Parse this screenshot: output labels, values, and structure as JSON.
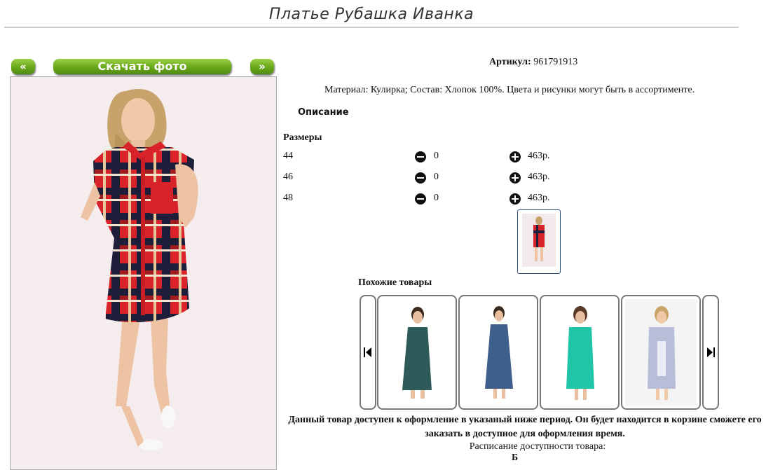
{
  "product": {
    "title": "Платье Рубашка Иванка",
    "artikul_label": "Артикул:",
    "artikul_value": "961791913",
    "material": "Материал: Кулирка; Состав: Хлопок 100%. Цвета и рисунки могут быть в ассортименте.",
    "description_label": "Описание",
    "sizes_label": "Размеры"
  },
  "photo_nav": {
    "prev_label": "«",
    "download_label": "Скачать фото",
    "next_label": "»"
  },
  "sizes": [
    {
      "size": "44",
      "qty": "0",
      "price": "463р."
    },
    {
      "size": "46",
      "qty": "0",
      "price": "463р."
    },
    {
      "size": "48",
      "qty": "0",
      "price": "463р."
    }
  ],
  "similar": {
    "label": "Похожие товары",
    "items": [
      {
        "dress_color": "#2f5a5a"
      },
      {
        "dress_color": "#3e5e8c"
      },
      {
        "dress_color": "#1fc5a6"
      },
      {
        "dress_color": "#b8bed8"
      }
    ]
  },
  "availability": {
    "notice": "Данный товар доступен к оформление в указаный ниже период. Он будет находится в корзине сможете его заказать в доступное для оформления время.",
    "schedule_label": "Расписание доступности товара:",
    "schedule_extra": "Б"
  },
  "colors": {
    "button_green": "#6fae1e",
    "plaid_red": "#d8232a",
    "plaid_navy": "#1d1f3a",
    "thumb_border": "#2a4f7a"
  },
  "icons": {
    "minus": "minus-circle-icon",
    "plus": "plus-circle-icon",
    "carousel_prev": "skip-back-icon",
    "carousel_next": "skip-forward-icon"
  }
}
